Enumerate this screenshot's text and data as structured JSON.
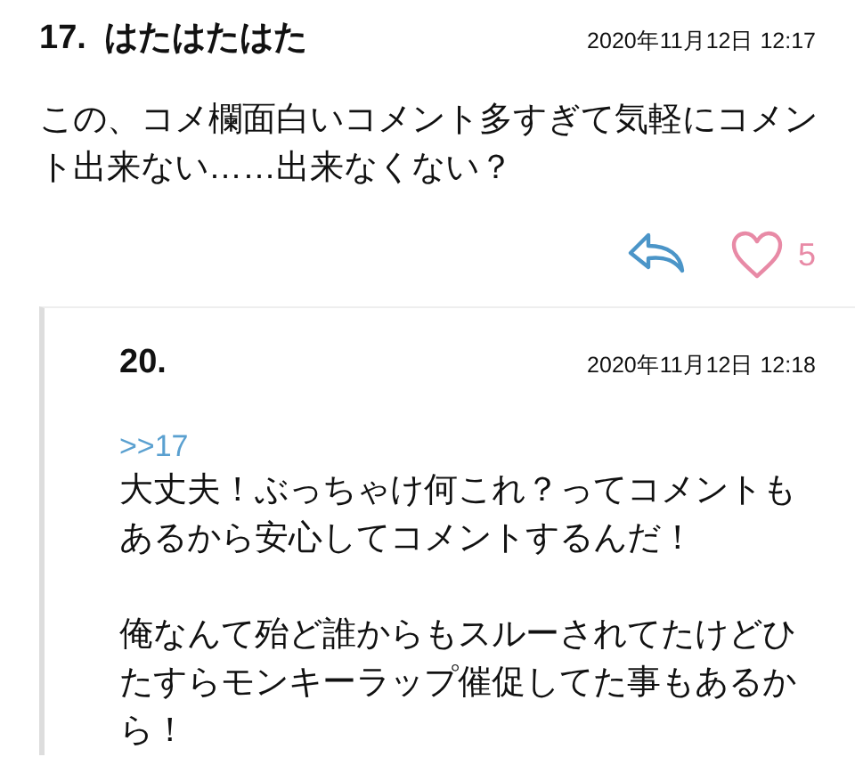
{
  "comment": {
    "number": "17.",
    "name": "はたはたはた",
    "date": "2020年11月12日 12:17",
    "paragraphs": [
      "この、コメ欄面白いコメント多すぎて気軽にコメント出来ない……出来なくない？"
    ],
    "likes": "5"
  },
  "reply": {
    "number": "20.",
    "date": "2020年11月12日 12:18",
    "anchor": ">>17",
    "paragraphs": [
      "大丈夫！ぶっちゃけ何これ？ってコメントもあるから安心してコメントするんだ！",
      "俺なんて殆ど誰からもスルーされてたけどひたすらモンキーラップ催促してた事もあるから！"
    ]
  }
}
